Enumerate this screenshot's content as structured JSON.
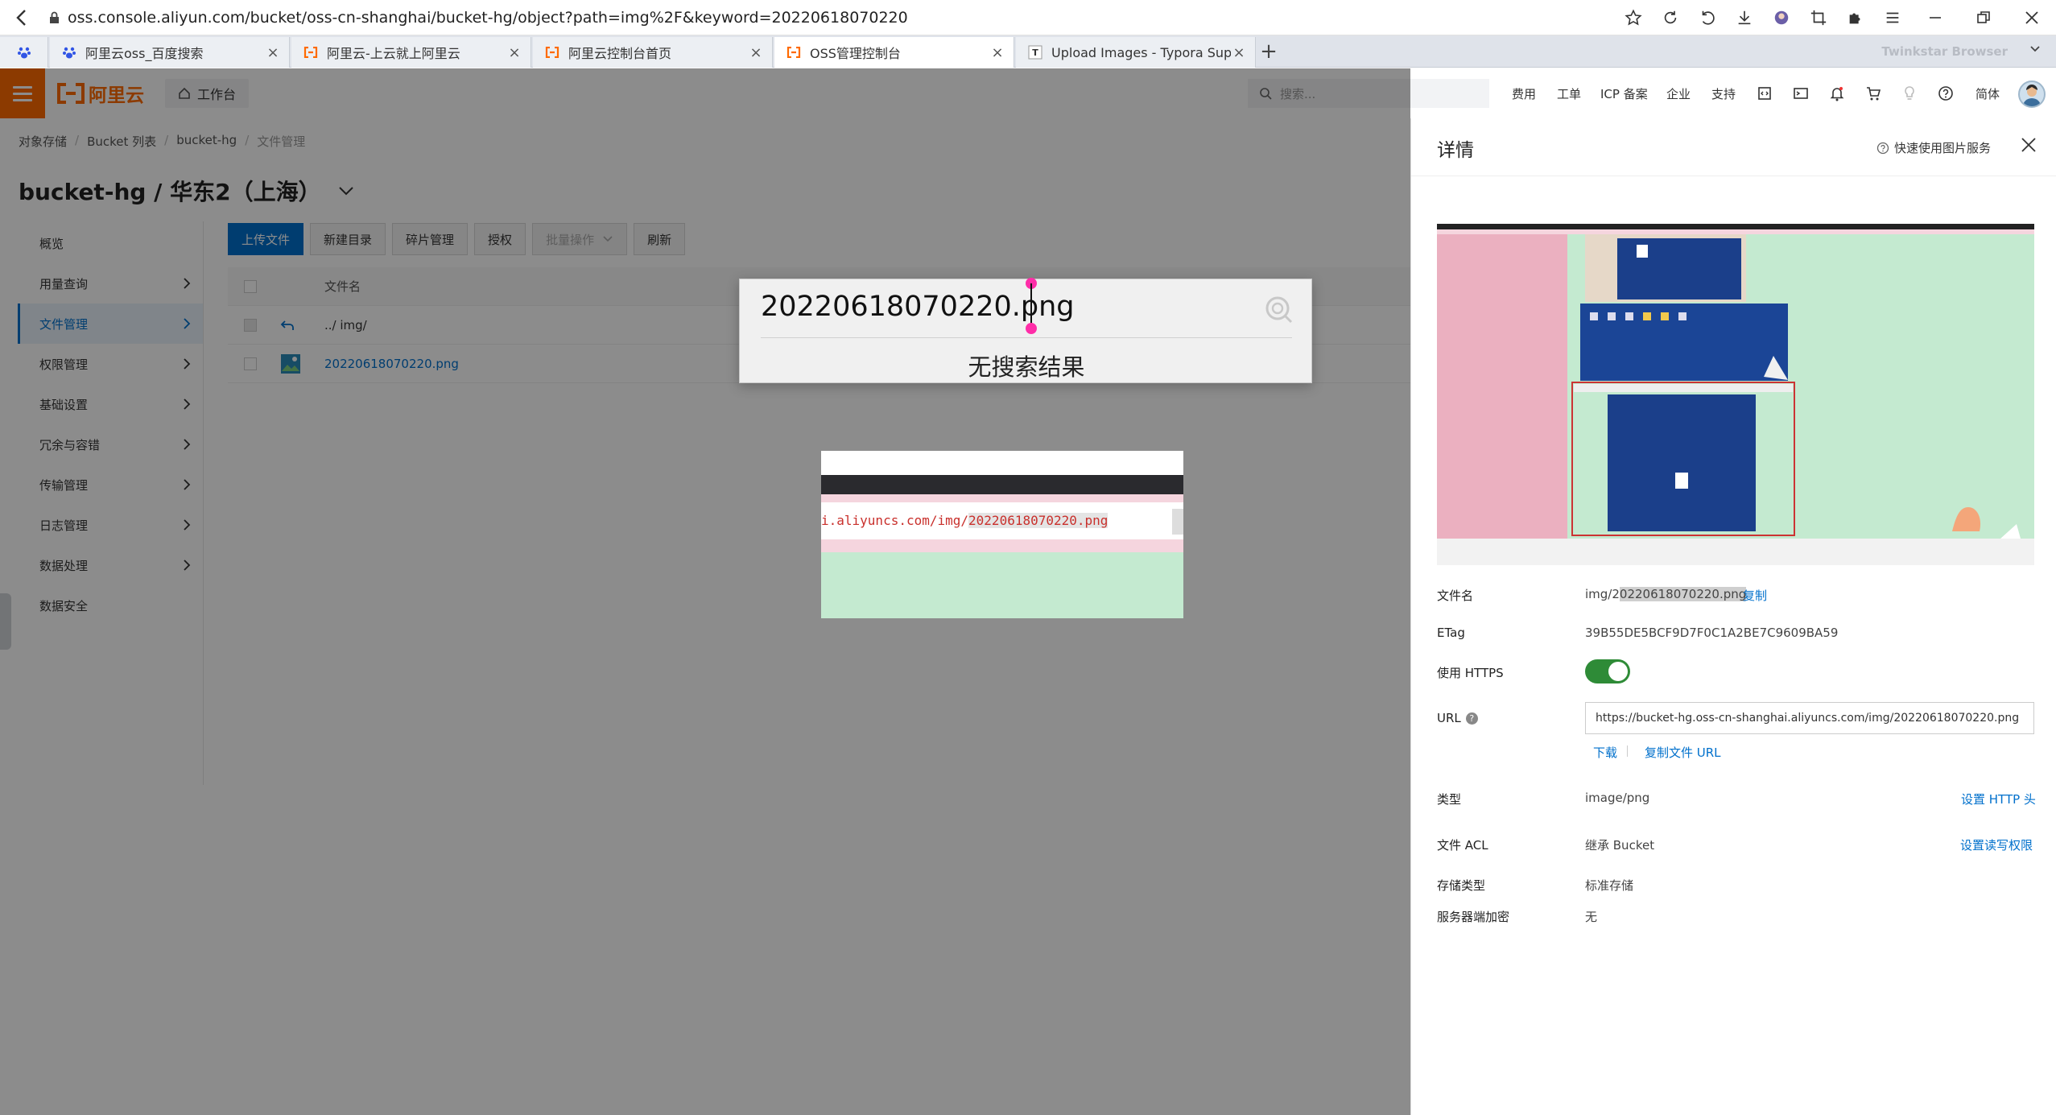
{
  "browser": {
    "url": "oss.console.aliyun.com/bucket/oss-cn-shanghai/bucket-hg/object?path=img%2F&keyword=20220618070220",
    "tabs": [
      {
        "label": "阿里云oss_百度搜索"
      },
      {
        "label": "阿里云-上云就上阿里云"
      },
      {
        "label": "阿里云控制台首页"
      },
      {
        "label": "OSS管理控制台"
      },
      {
        "label": "Upload Images - Typora Sup"
      }
    ],
    "brand": "Twinkstar Browser"
  },
  "header": {
    "logo_text": "阿里云",
    "workbench": "工作台",
    "search_placeholder": "搜索...",
    "nav": [
      "费用",
      "工单",
      "ICP 备案",
      "企业",
      "支持"
    ],
    "lang": "简体",
    "accent_color": "#ff6a00"
  },
  "breadcrumb": [
    "对象存储",
    "Bucket 列表",
    "bucket-hg",
    "文件管理"
  ],
  "bucket_title": "bucket-hg / 华东2（上海）",
  "sidebar": [
    {
      "label": "概览",
      "expandable": false
    },
    {
      "label": "用量查询",
      "expandable": true
    },
    {
      "label": "文件管理",
      "expandable": true,
      "active": true
    },
    {
      "label": "权限管理",
      "expandable": true
    },
    {
      "label": "基础设置",
      "expandable": true
    },
    {
      "label": "冗余与容错",
      "expandable": true
    },
    {
      "label": "传输管理",
      "expandable": true
    },
    {
      "label": "日志管理",
      "expandable": true
    },
    {
      "label": "数据处理",
      "expandable": true
    },
    {
      "label": "数据安全",
      "expandable": false
    }
  ],
  "toolbar": {
    "upload": "上传文件",
    "new_dir": "新建目录",
    "fragments": "碎片管理",
    "authorize": "授权",
    "batch": "批量操作",
    "refresh": "刷新"
  },
  "file_table": {
    "column_name": "文件名",
    "parent_row": "../ img/",
    "file_row": "20220618070220.png"
  },
  "drawer": {
    "title": "详情",
    "quick_link": "快速使用图片服务",
    "fields": {
      "filename_label": "文件名",
      "filename_prefix": "img/2",
      "filename_highlight": "0220618070220.png",
      "copy": "复制",
      "etag_label": "ETag",
      "etag": "39B55DE5BCF9D7F0C1A2BE7C9609BA59",
      "https_label": "使用 HTTPS",
      "https_enabled": true,
      "url_label": "URL",
      "url": "https://bucket-hg.oss-cn-shanghai.aliyuncs.com/img/20220618070220.png",
      "download": "下载",
      "copy_url": "复制文件 URL",
      "type_label": "类型",
      "type": "image/png",
      "set_http_header": "设置 HTTP 头",
      "acl_label": "文件 ACL",
      "acl": "继承 Bucket",
      "set_acl": "设置读写权限",
      "storage_label": "存储类型",
      "storage": "标准存储",
      "encrypt_label": "服务器端加密",
      "encrypt": "无"
    }
  },
  "find": {
    "query": "20220618070220.png",
    "result": "无搜索结果"
  },
  "snippet": {
    "code_before": "i.aliyuncs.com/img/",
    "code_selected": "20220618070220.png"
  }
}
